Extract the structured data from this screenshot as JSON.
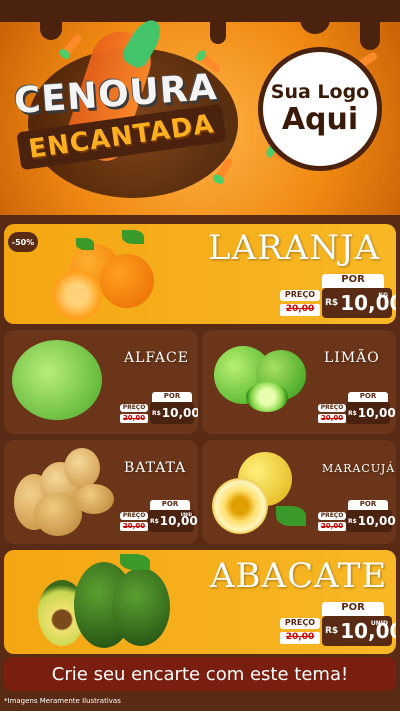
{
  "banner": {
    "title_line1": "CENOURA",
    "title_line2": "ENCANTADA",
    "logo_line1": "Sua Logo",
    "logo_line2": "Aqui"
  },
  "colors": {
    "accent": "#f5ad1a",
    "dark": "#5a2b14",
    "cta": "#7a1f10"
  },
  "products": {
    "laranja": {
      "name": "LARANJA",
      "discount": "-50%",
      "por": "POR",
      "preco": "PREÇO",
      "old_price": "20,00",
      "currency": "R$",
      "price": "10,00",
      "unit": "KG"
    },
    "alface": {
      "name": "ALFACE",
      "por": "POR",
      "preco": "PREÇO",
      "old_price": "20,00",
      "currency": "R$",
      "price": "10,00"
    },
    "limao": {
      "name": "LIMÃO",
      "por": "POR",
      "preco": "PREÇO",
      "old_price": "20,00",
      "currency": "R$",
      "price": "10,00"
    },
    "batata": {
      "name": "BATATA",
      "por": "POR",
      "preco": "PREÇO",
      "old_price": "20,00",
      "currency": "R$",
      "price": "10,00",
      "unit": "UNID"
    },
    "maracuja": {
      "name": "MARACUJÁ",
      "por": "POR",
      "preco": "PREÇO",
      "old_price": "20,00",
      "currency": "R$",
      "price": "10,00"
    },
    "abacate": {
      "name": "ABACATE",
      "por": "POR",
      "preco": "PREÇO",
      "old_price": "20,00",
      "currency": "R$",
      "price": "10,00",
      "unit": "UNID"
    }
  },
  "cta": "Crie seu encarte com este tema!",
  "footer": "*Imagens Meramente Ilustrativas"
}
